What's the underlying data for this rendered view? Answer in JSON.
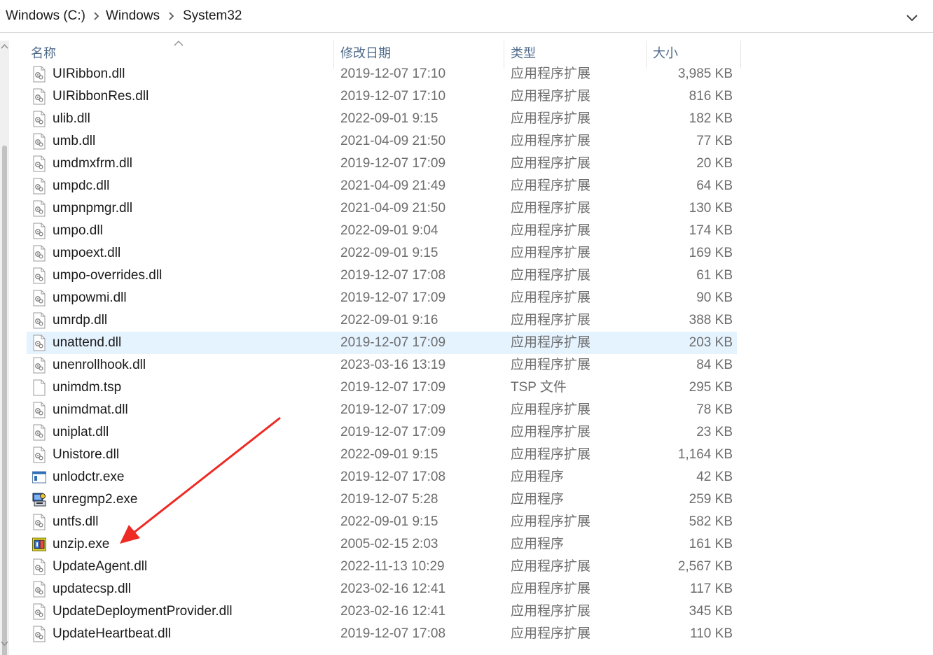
{
  "breadcrumb": {
    "items": [
      "Windows (C:)",
      "Windows",
      "System32"
    ]
  },
  "columns": {
    "name": "名称",
    "date": "修改日期",
    "type": "类型",
    "size": "大小"
  },
  "files": [
    {
      "name": "UIRibbon.dll",
      "date": "2019-12-07 17:10",
      "type": "应用程序扩展",
      "size": "3,985 KB",
      "icon": "dll-icon"
    },
    {
      "name": "UIRibbonRes.dll",
      "date": "2019-12-07 17:10",
      "type": "应用程序扩展",
      "size": "816 KB",
      "icon": "dll-icon"
    },
    {
      "name": "ulib.dll",
      "date": "2022-09-01 9:15",
      "type": "应用程序扩展",
      "size": "182 KB",
      "icon": "dll-icon"
    },
    {
      "name": "umb.dll",
      "date": "2021-04-09 21:50",
      "type": "应用程序扩展",
      "size": "77 KB",
      "icon": "dll-icon"
    },
    {
      "name": "umdmxfrm.dll",
      "date": "2019-12-07 17:09",
      "type": "应用程序扩展",
      "size": "20 KB",
      "icon": "dll-icon"
    },
    {
      "name": "umpdc.dll",
      "date": "2021-04-09 21:49",
      "type": "应用程序扩展",
      "size": "64 KB",
      "icon": "dll-icon"
    },
    {
      "name": "umpnpmgr.dll",
      "date": "2021-04-09 21:50",
      "type": "应用程序扩展",
      "size": "130 KB",
      "icon": "dll-icon"
    },
    {
      "name": "umpo.dll",
      "date": "2022-09-01 9:04",
      "type": "应用程序扩展",
      "size": "174 KB",
      "icon": "dll-icon"
    },
    {
      "name": "umpoext.dll",
      "date": "2022-09-01 9:15",
      "type": "应用程序扩展",
      "size": "169 KB",
      "icon": "dll-icon"
    },
    {
      "name": "umpo-overrides.dll",
      "date": "2019-12-07 17:08",
      "type": "应用程序扩展",
      "size": "61 KB",
      "icon": "dll-icon"
    },
    {
      "name": "umpowmi.dll",
      "date": "2019-12-07 17:09",
      "type": "应用程序扩展",
      "size": "90 KB",
      "icon": "dll-icon"
    },
    {
      "name": "umrdp.dll",
      "date": "2022-09-01 9:16",
      "type": "应用程序扩展",
      "size": "388 KB",
      "icon": "dll-icon"
    },
    {
      "name": "unattend.dll",
      "date": "2019-12-07 17:09",
      "type": "应用程序扩展",
      "size": "203 KB",
      "icon": "dll-icon",
      "selected": true
    },
    {
      "name": "unenrollhook.dll",
      "date": "2023-03-16 13:19",
      "type": "应用程序扩展",
      "size": "84 KB",
      "icon": "dll-icon"
    },
    {
      "name": "unimdm.tsp",
      "date": "2019-12-07 17:09",
      "type": "TSP 文件",
      "size": "295 KB",
      "icon": "blank-file-icon"
    },
    {
      "name": "unimdmat.dll",
      "date": "2019-12-07 17:09",
      "type": "应用程序扩展",
      "size": "78 KB",
      "icon": "dll-icon"
    },
    {
      "name": "uniplat.dll",
      "date": "2019-12-07 17:09",
      "type": "应用程序扩展",
      "size": "23 KB",
      "icon": "dll-icon"
    },
    {
      "name": "Unistore.dll",
      "date": "2022-09-01 9:15",
      "type": "应用程序扩展",
      "size": "1,164 KB",
      "icon": "dll-icon"
    },
    {
      "name": "unlodctr.exe",
      "date": "2019-12-07 17:08",
      "type": "应用程序",
      "size": "42 KB",
      "icon": "exe-window-icon"
    },
    {
      "name": "unregmp2.exe",
      "date": "2019-12-07 5:28",
      "type": "应用程序",
      "size": "259 KB",
      "icon": "media-installer-icon"
    },
    {
      "name": "untfs.dll",
      "date": "2022-09-01 9:15",
      "type": "应用程序扩展",
      "size": "582 KB",
      "icon": "dll-icon"
    },
    {
      "name": "unzip.exe",
      "date": "2005-02-15 2:03",
      "type": "应用程序",
      "size": "161 KB",
      "icon": "unzip-app-icon"
    },
    {
      "name": "UpdateAgent.dll",
      "date": "2022-11-13 10:29",
      "type": "应用程序扩展",
      "size": "2,567 KB",
      "icon": "dll-icon"
    },
    {
      "name": "updatecsp.dll",
      "date": "2023-02-16 12:41",
      "type": "应用程序扩展",
      "size": "117 KB",
      "icon": "dll-icon"
    },
    {
      "name": "UpdateDeploymentProvider.dll",
      "date": "2023-02-16 12:41",
      "type": "应用程序扩展",
      "size": "345 KB",
      "icon": "dll-icon"
    },
    {
      "name": "UpdateHeartbeat.dll",
      "date": "2019-12-07 17:08",
      "type": "应用程序扩展",
      "size": "110 KB",
      "icon": "dll-icon"
    }
  ],
  "colors": {
    "selection": "#e5f3ff",
    "header_text": "#4d6a8a",
    "annotation_arrow": "#ee2a24"
  }
}
